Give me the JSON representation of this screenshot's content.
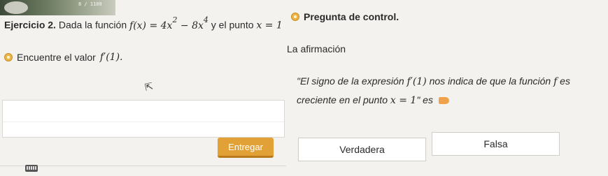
{
  "exercise": {
    "title": "Ejercicio 2.",
    "prefix": "Dada la función",
    "function_lhs": "f(x) = 4x",
    "exp1": "2",
    "function_mid": " − 8x",
    "exp2": "4",
    "connector": "y el punto",
    "point": "x = 1"
  },
  "control": {
    "label": "Pregunta de control."
  },
  "task": {
    "prefix": "Encuentre el valor",
    "expression": "f′(1)."
  },
  "affirmation": {
    "label": "La afirmación",
    "line1_text": "\"El signo de la expresión",
    "line1_expr": "f′(1)",
    "line1_tail": "nos indica de que la función",
    "line1_f": "f",
    "line1_end": "es",
    "line2_text": "creciente en el punto",
    "line2_expr": "x = 1",
    "line2_end": "\" es"
  },
  "submit": {
    "label": "Entregar"
  },
  "choices": {
    "true_label": "Verdadera",
    "false_label": "Falsa"
  },
  "thumb": {
    "text": "8 / 1108"
  },
  "colors": {
    "accent": "#e2a137",
    "background": "#f3f2ee"
  },
  "icons": [
    "coin-icon",
    "pointer-icon",
    "cursor-icon",
    "keyboard-icon"
  ]
}
